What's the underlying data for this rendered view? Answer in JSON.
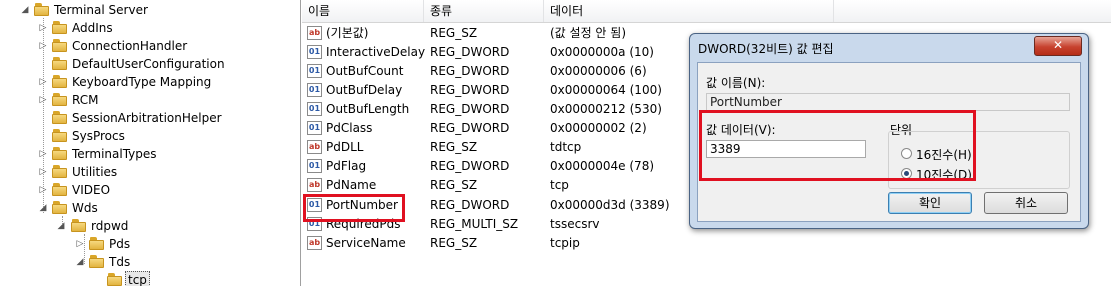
{
  "tree": {
    "items": [
      {
        "label": "Terminal Server"
      },
      {
        "label": "AddIns"
      },
      {
        "label": "ConnectionHandler"
      },
      {
        "label": "DefaultUserConfiguration"
      },
      {
        "label": "KeyboardType Mapping"
      },
      {
        "label": "RCM"
      },
      {
        "label": "SessionArbitrationHelper"
      },
      {
        "label": "SysProcs"
      },
      {
        "label": "TerminalTypes"
      },
      {
        "label": "Utilities"
      },
      {
        "label": "VIDEO"
      },
      {
        "label": "Wds"
      },
      {
        "label": "rdpwd"
      },
      {
        "label": "Pds"
      },
      {
        "label": "Tds"
      },
      {
        "label": "tcp"
      }
    ]
  },
  "list": {
    "columns": {
      "name": "이름",
      "type": "종류",
      "data": "데이터"
    },
    "rows": [
      {
        "icon": "string-value-icon",
        "name": "(기본값)",
        "type": "REG_SZ",
        "data": "(값 설정 안 됨)"
      },
      {
        "icon": "binary-value-icon",
        "name": "InteractiveDelay",
        "type": "REG_DWORD",
        "data": "0x0000000a (10)"
      },
      {
        "icon": "binary-value-icon",
        "name": "OutBufCount",
        "type": "REG_DWORD",
        "data": "0x00000006 (6)"
      },
      {
        "icon": "binary-value-icon",
        "name": "OutBufDelay",
        "type": "REG_DWORD",
        "data": "0x00000064 (100)"
      },
      {
        "icon": "binary-value-icon",
        "name": "OutBufLength",
        "type": "REG_DWORD",
        "data": "0x00000212 (530)"
      },
      {
        "icon": "binary-value-icon",
        "name": "PdClass",
        "type": "REG_DWORD",
        "data": "0x00000002 (2)"
      },
      {
        "icon": "string-value-icon",
        "name": "PdDLL",
        "type": "REG_SZ",
        "data": "tdtcp"
      },
      {
        "icon": "binary-value-icon",
        "name": "PdFlag",
        "type": "REG_DWORD",
        "data": "0x0000004e (78)"
      },
      {
        "icon": "string-value-icon",
        "name": "PdName",
        "type": "REG_SZ",
        "data": "tcp"
      },
      {
        "icon": "binary-value-icon",
        "name": "PortNumber",
        "type": "REG_DWORD",
        "data": "0x00000d3d (3389)"
      },
      {
        "icon": "binary-value-icon",
        "name": "RequiredPds",
        "type": "REG_MULTI_SZ",
        "data": "tssecsrv"
      },
      {
        "icon": "string-value-icon",
        "name": "ServiceName",
        "type": "REG_SZ",
        "data": "tcpip"
      }
    ]
  },
  "dialog": {
    "title": "DWORD(32비트) 값 편집",
    "close_glyph": "✕",
    "value_name_label": "값 이름(N):",
    "value_name": "PortNumber",
    "value_data_label": "값 데이터(V):",
    "value_data": "3389",
    "base_label": "단위",
    "hex_label": "16진수(H)",
    "dec_label": "10진수(D)",
    "base_selected": "decimal",
    "ok_label": "확인",
    "cancel_label": "취소"
  },
  "colors": {
    "highlight_box": "#e01020",
    "dialog_frame": "#c9d9ec"
  }
}
